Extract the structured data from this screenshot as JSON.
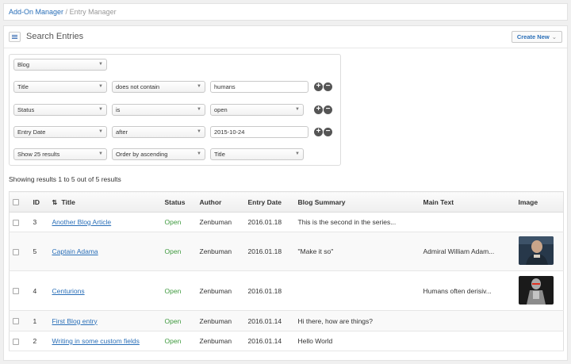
{
  "breadcrumb": {
    "root": "Add-On Manager",
    "separator": " / ",
    "current": "Entry Manager"
  },
  "header": {
    "title": "Search Entries",
    "create_label": "Create New"
  },
  "filters": {
    "channel": "Blog",
    "rows": [
      {
        "field": "Title",
        "operator": "does not contain",
        "value": "humans",
        "value_type": "input"
      },
      {
        "field": "Status",
        "operator": "is",
        "value": "open",
        "value_type": "select"
      },
      {
        "field": "Entry Date",
        "operator": "after",
        "value": "2015-10-24",
        "value_type": "input"
      }
    ],
    "footer": {
      "limit": "Show 25 results",
      "order": "Order by ascending",
      "orderby": "Title"
    }
  },
  "results_text": "Showing results 1 to 5 out of 5 results",
  "table": {
    "columns": [
      "ID",
      "Title",
      "Status",
      "Author",
      "Entry Date",
      "Blog Summary",
      "Main Text",
      "Image"
    ],
    "rows": [
      {
        "id": "3",
        "title": "Another Blog Article",
        "status": "Open",
        "author": "Zenbuman",
        "date": "2016.01.18",
        "summary": "This is the second in the series...",
        "main": "",
        "image": ""
      },
      {
        "id": "5",
        "title": "Captain Adama",
        "status": "Open",
        "author": "Zenbuman",
        "date": "2016.01.18",
        "summary": "\"Make it so\"",
        "main": "Admiral William Adam...",
        "image": "portrait"
      },
      {
        "id": "4",
        "title": "Centurions",
        "status": "Open",
        "author": "Zenbuman",
        "date": "2016.01.18",
        "summary": "",
        "main": "Humans often derisiv...",
        "image": "robot"
      },
      {
        "id": "1",
        "title": "First Blog entry",
        "status": "Open",
        "author": "Zenbuman",
        "date": "2016.01.14",
        "summary": "Hi there, how are things?",
        "main": "",
        "image": ""
      },
      {
        "id": "2",
        "title": "Writing in some custom fields",
        "status": "Open",
        "author": "Zenbuman",
        "date": "2016.01.14",
        "summary": "Hello World",
        "main": "",
        "image": ""
      }
    ]
  },
  "colors": {
    "link": "#2a6fb8",
    "status_open": "#3f9a3f"
  }
}
